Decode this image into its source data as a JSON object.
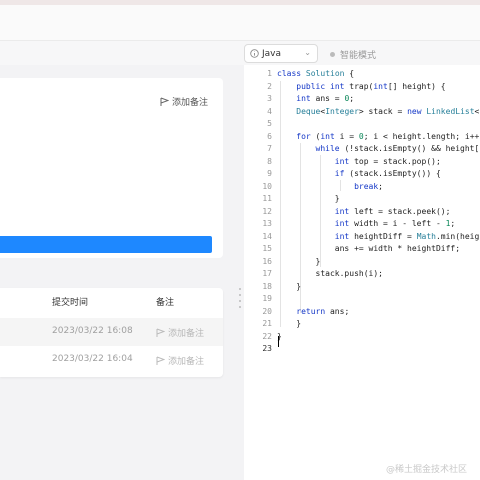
{
  "left_panel": {
    "add_note_label": "添加备注",
    "table": {
      "col_time": "提交时间",
      "col_note": "备注",
      "rows": [
        {
          "time": "2023/03/22 16:08",
          "note": "添加备注"
        },
        {
          "time": "2023/03/22 16:04",
          "note": "添加备注"
        }
      ]
    }
  },
  "editor_bar": {
    "language": "Java",
    "smart_mode": "智能模式"
  },
  "code": {
    "line_numbers": [
      "1",
      "2",
      "3",
      "4",
      "5",
      "6",
      "7",
      "8",
      "9",
      "10",
      "11",
      "12",
      "13",
      "14",
      "15",
      "16",
      "17",
      "18",
      "19",
      "20",
      "21",
      "22",
      "23"
    ],
    "current_line": "23"
  },
  "watermark": "@稀土掘金技术社区",
  "icons": {
    "flag": "flag-icon",
    "info": "info-circle-icon",
    "chevron": "chevron-down-icon"
  }
}
